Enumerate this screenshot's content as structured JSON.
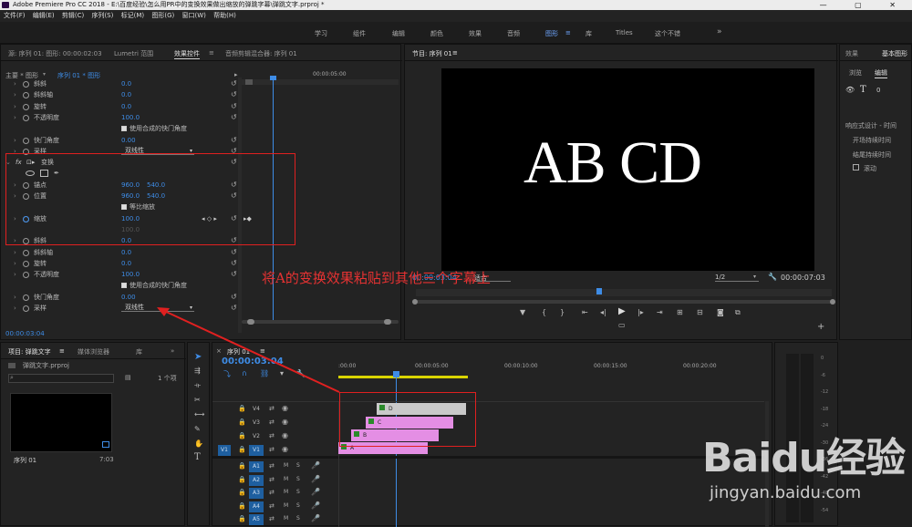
{
  "titlebar": {
    "text": "Adobe Premiere Pro CC 2018 - E:\\百度经验\\怎么用PR中的变换效果做出缩放的弹跳字幕\\弹跳文字.prproj *",
    "buttons": "— ▢ ✕"
  },
  "menubar": {
    "items": [
      "文件(F)",
      "编辑(E)",
      "剪辑(C)",
      "序列(S)",
      "标记(M)",
      "图形(G)",
      "窗口(W)",
      "帮助(H)"
    ]
  },
  "workspace": {
    "tabs": [
      "学习",
      "组件",
      "编辑",
      "颜色",
      "效果",
      "音频",
      "图形",
      "库",
      "Titles",
      "这个不错"
    ],
    "active": "图形",
    "more": "»"
  },
  "effect_controls": {
    "tabs": [
      "源: 序列 01: 图形: 00:00:02:03",
      "Lumetri 范围",
      "效果控件",
      "音频剪辑混合器: 序列 01"
    ],
    "active_tab": "效果控件",
    "master": "主要 * 图形",
    "clip": "序列 01 * 图形",
    "ruler_time": "00:00:05:00",
    "rows": [
      {
        "name": "斜斜",
        "v1": "0.0"
      },
      {
        "name": "斜斜轴",
        "v1": "0.0"
      },
      {
        "name": "旋转",
        "v1": "0.0"
      },
      {
        "name": "不透明度",
        "v1": "100.0"
      },
      {
        "name": "",
        "check": "使用合成的快门角度"
      },
      {
        "name": "快门角度",
        "v1": "0.00"
      },
      {
        "name": "采样",
        "select": "双线性"
      },
      {
        "name": "变换",
        "fx": true
      },
      {
        "name": "",
        "shapes": true
      },
      {
        "name": "锚点",
        "v1": "960.0",
        "v2": "540.0"
      },
      {
        "name": "位置",
        "v1": "960.0",
        "v2": "540.0"
      },
      {
        "name": "",
        "check": "等比缩放"
      },
      {
        "name": "缩放",
        "v1": "100.0",
        "keyframe": true
      },
      {
        "name": "",
        "v1": "100.0",
        "dim": true
      },
      {
        "name": "斜斜",
        "v1": "0.0"
      },
      {
        "name": "斜斜轴",
        "v1": "0.0"
      },
      {
        "name": "旋转",
        "v1": "0.0"
      },
      {
        "name": "不透明度",
        "v1": "100.0"
      },
      {
        "name": "",
        "check": "使用合成的快门角度"
      },
      {
        "name": "快门角度",
        "v1": "0.00"
      },
      {
        "name": "采样",
        "select": "双线性"
      }
    ],
    "timecode": "00:00:03:04"
  },
  "annotation": "将A的变换效果粘贴到其他三个字幕上",
  "program": {
    "title": "节目: 序列 01",
    "text": "AB CD",
    "timecode": "00:00:03:04",
    "fit": "适合",
    "res": "1/2",
    "duration": "00:00:07:03"
  },
  "essential_graphics": {
    "tabs": [
      "效果",
      "基本图形"
    ],
    "subtabs": [
      "浏览",
      "编辑"
    ],
    "layer": "0",
    "section": "响应式设计 - 时间",
    "intro": "开场持续时间",
    "outro": "结尾持续时间",
    "roll": "滚动"
  },
  "project": {
    "tabs": [
      "项目: 弹跳文字",
      "媒体浏览器",
      "库"
    ],
    "file": "弹跳文字.prproj",
    "count": "1 个项",
    "item_name": "序列 01",
    "item_dur": "7:03"
  },
  "timeline": {
    "tab": "序列 01",
    "timecode": "00:00:03:04",
    "ruler": [
      ":00:00",
      "00:00:05:00",
      "00:00:10:00",
      "00:00:15:00",
      "00:00:20:00"
    ],
    "video_tracks": [
      "V4",
      "V3",
      "V2",
      "V1"
    ],
    "audio_tracks": [
      "A1",
      "A2",
      "A3",
      "A4",
      "A5"
    ],
    "clips": [
      {
        "label": "D",
        "track": "V4",
        "color": "#c9c9c9"
      },
      {
        "label": "C",
        "track": "V3",
        "color": "#e48ee4"
      },
      {
        "label": "B",
        "track": "V2",
        "color": "#e48ee4"
      },
      {
        "label": "A",
        "track": "V1",
        "color": "#e48ee4"
      }
    ],
    "meter_ticks": [
      "0",
      "-6",
      "-12",
      "-18",
      "-24",
      "-30",
      "-36",
      "-42",
      "-48",
      "-54"
    ]
  },
  "watermark": {
    "brand": "Baidu经验",
    "url": "jingyan.baidu.com"
  }
}
